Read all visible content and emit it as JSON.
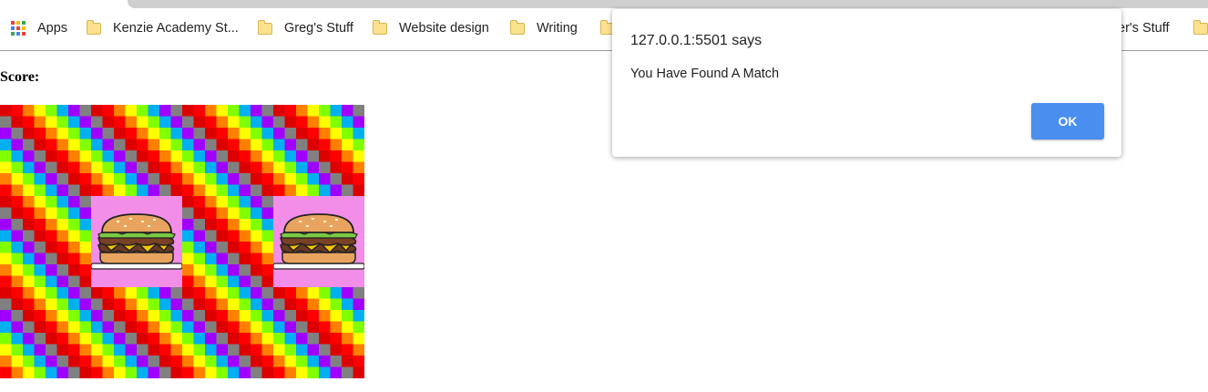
{
  "bookmarks_bar": {
    "apps_label": "Apps",
    "items": [
      {
        "label": "Kenzie Academy St..."
      },
      {
        "label": "Greg's Stuff"
      },
      {
        "label": "Website design"
      },
      {
        "label": "Writing"
      },
      {
        "label": ""
      },
      {
        "label": "er's Stuff"
      },
      {
        "label": ""
      }
    ]
  },
  "page": {
    "score_label": "Score:",
    "board": {
      "columns": 4,
      "rows": 3,
      "cards": [
        {
          "state": "face-down"
        },
        {
          "state": "face-down"
        },
        {
          "state": "face-down"
        },
        {
          "state": "face-down"
        },
        {
          "state": "face-down"
        },
        {
          "state": "face-up",
          "image": "cheeseburger-icon"
        },
        {
          "state": "face-down"
        },
        {
          "state": "face-up",
          "image": "cheeseburger-icon"
        },
        {
          "state": "face-down"
        },
        {
          "state": "face-down"
        },
        {
          "state": "face-down"
        },
        {
          "state": "face-down"
        }
      ],
      "card_back_colors": [
        "#ff0000",
        "#ff8000",
        "#ffff00",
        "#80ff00",
        "#00b0f0",
        "#a000ff",
        "#808080",
        "#dd0000"
      ],
      "card_face_background": "#f28ee8"
    }
  },
  "dialog": {
    "title": "127.0.0.1:5501 says",
    "message": "You Have Found A Match",
    "ok_label": "OK",
    "accent_color": "#4a8ef0"
  }
}
